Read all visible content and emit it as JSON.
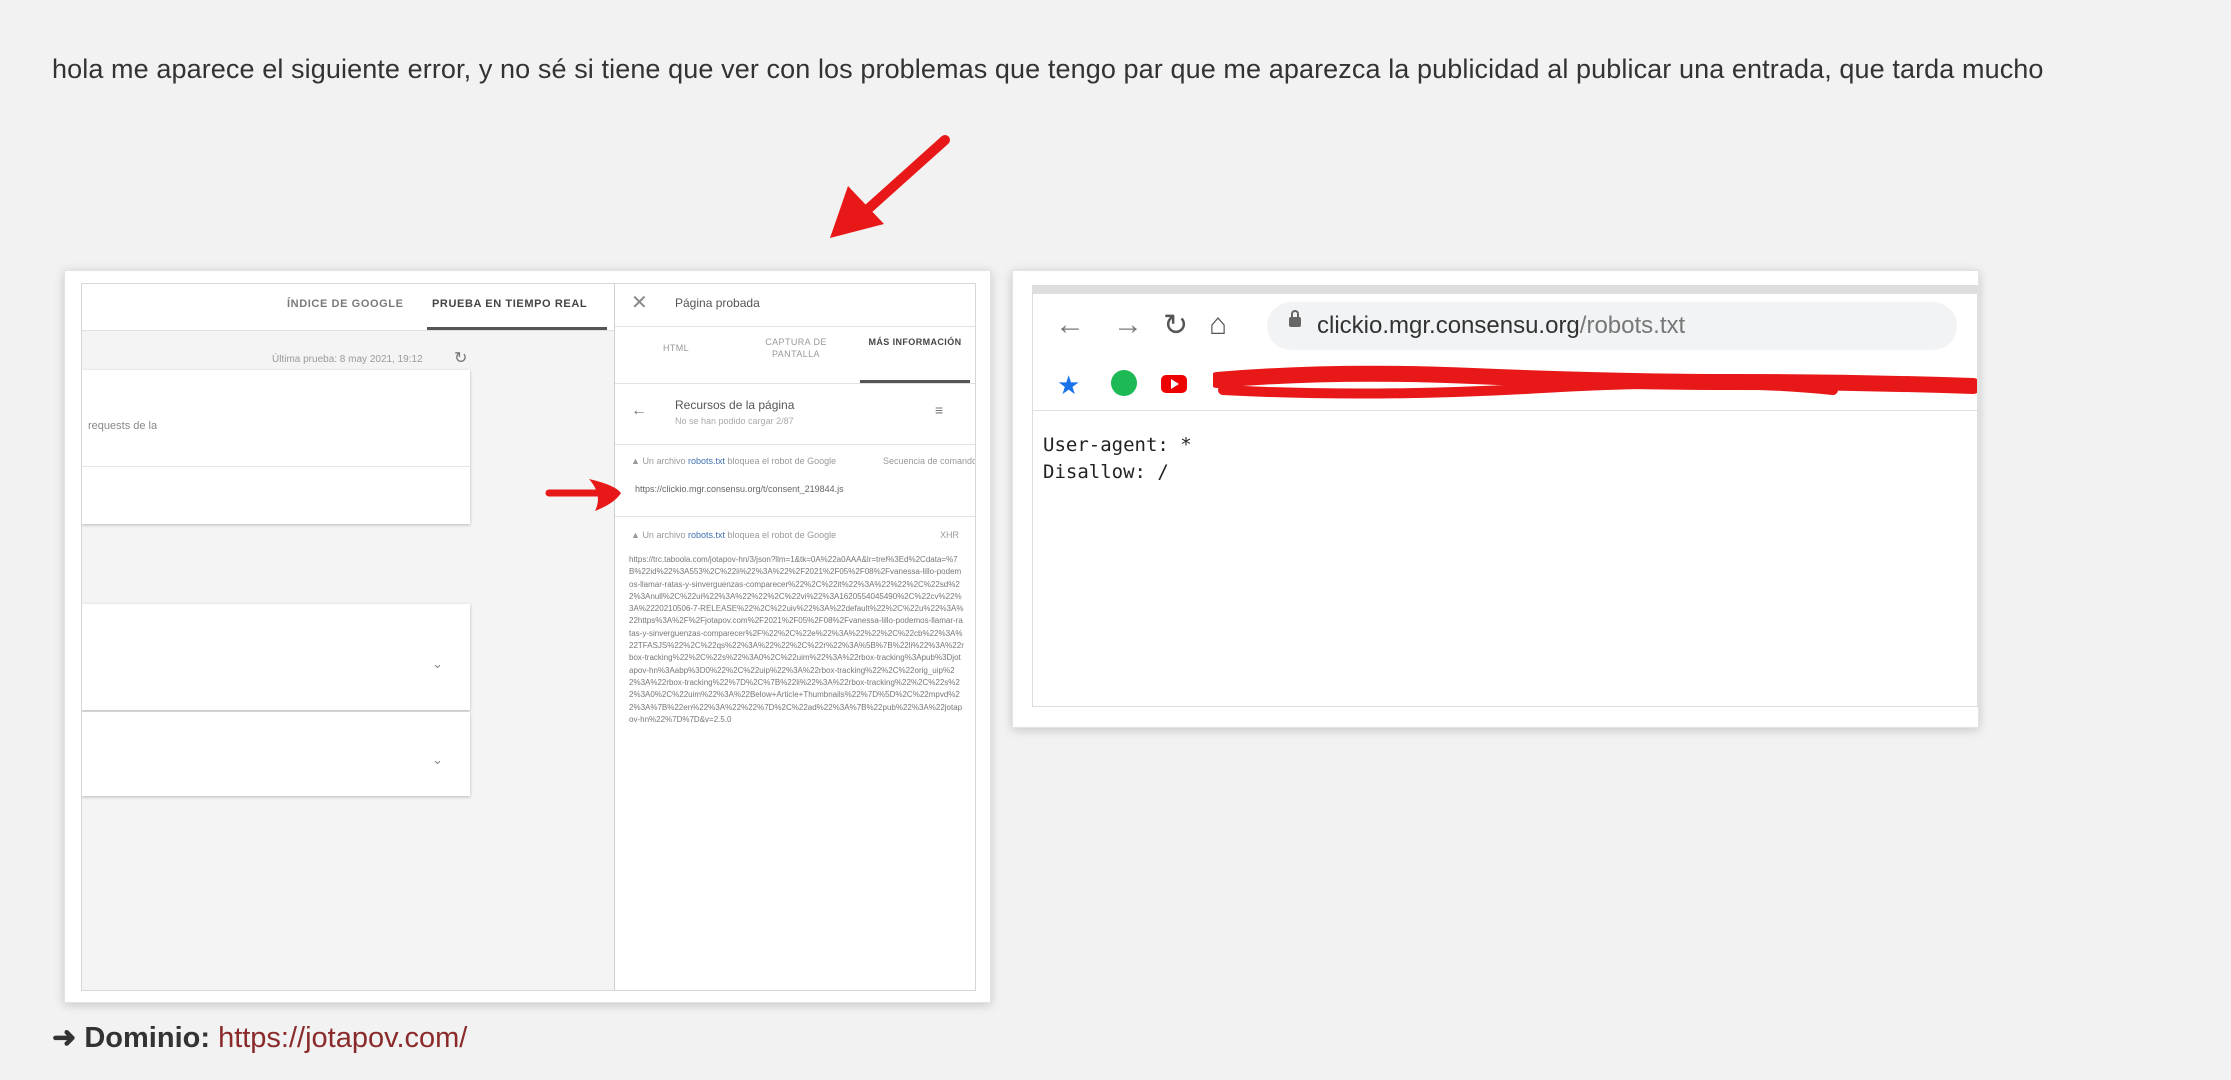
{
  "post": {
    "intro": "hola me aparece el siguiente error, y no sé si tiene que ver con los problemas que tengo par que me aparezca la publicidad al publicar una entrada, que tarda mucho",
    "domain_label": "➜ Dominio:",
    "domain_link": "https://jotapov.com/"
  },
  "screenshot1": {
    "tabs": [
      "ÍNDICE DE GOOGLE",
      "PRUEBA EN TIEMPO REAL"
    ],
    "last_test": "Última prueba: 8 may 2021, 19:12",
    "card_text": "requests de la",
    "panel_title": "Página probada",
    "panel_tabs": [
      "HTML",
      "CAPTURA DE PANTALLA",
      "MÁS INFORMACIÓN"
    ],
    "resources_title": "Recursos de la página",
    "resources_sub": "No se han podido cargar 2/87",
    "warning1_prefix": "Un archivo",
    "warning1_link": "robots.txt",
    "warning1_suffix": "bloquea el robot de Google",
    "warning1_type": "Secuencia de comandos",
    "warning1_url": "https://clickio.mgr.consensu.org/t/consent_219844.js",
    "warning2_prefix": "Un archivo",
    "warning2_link": "robots.txt",
    "warning2_suffix": "bloquea el robot de Google",
    "warning2_type": "XHR",
    "long_url": "https://trc.taboola.com/jotapov-hn/3/json?llm=1&tk=0A%22a0AAA&lr=trel%3Ed%2Cdata=%7B%22id%22%3A553%2C%22ii%22%3A%22%2F2021%2F05%2F08%2Fvanessa-lillo-podemos-llamar-ratas-y-sinverguenzas-comparecer%22%2C%22it%22%3A%22%22%2C%22sd%22%3Anull%2C%22ui%22%3A%22%22%2C%22vi%22%3A1620554045490%2C%22cv%22%3A%2220210506-7-RELEASE%22%2C%22uiv%22%3A%22default%22%2C%22u%22%3A%22https%3A%2F%2Fjotapov.com%2F2021%2F05%2F08%2Fvanessa-lillo-podemos-llamar-ratas-y-sinverguenzas-comparecer%2F%22%2C%22e%22%3A%22%22%2C%22cb%22%3A%22TFASJS%22%2C%22qs%22%3A%22%22%2C%22r%22%3A%5B%7B%22li%22%3A%22rbox-tracking%22%2C%22s%22%3A0%2C%22uim%22%3A%22rbox-tracking%3Apub%3Djotapov-hn%3Aabp%3D0%22%2C%22uip%22%3A%22rbox-tracking%22%2C%22orig_uip%22%3A%22rbox-tracking%22%7D%2C%7B%22li%22%3A%22rbox-tracking%22%2C%22s%22%3A0%2C%22uim%22%3A%22Below+Article+Thumbnails%22%7D%5D%2C%22mpvd%22%3A%7B%22en%22%3A%22%22%7D%2C%22ad%22%3A%7B%22pub%22%3A%22jotapov-hn%22%7D%7D&v=2.5.0"
  },
  "screenshot2": {
    "url_host": "clickio.mgr.consensu.org",
    "url_path": "/robots.txt",
    "robots_lines": "User-agent: *\nDisallow: /"
  },
  "colors": {
    "annotation_red": "#e81818",
    "link": "#8b2a2a",
    "background": "#f2f2f2"
  },
  "icons": {
    "annotation": "red-arrow-icon",
    "back": "arrow-left-icon",
    "forward": "arrow-right-icon",
    "reload": "reload-icon",
    "home": "home-icon",
    "lock": "lock-icon",
    "bookmark": "star-icon"
  }
}
